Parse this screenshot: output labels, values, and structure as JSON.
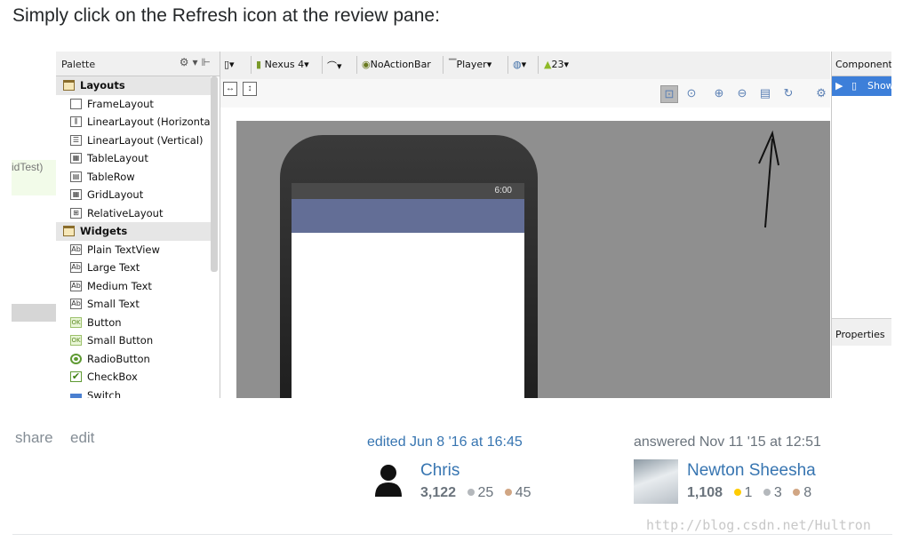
{
  "intro": "Simply click on the Refresh icon at the review pane:",
  "screenshot": {
    "gutter_text": "idTest)",
    "palette": {
      "title": "Palette",
      "items": [
        {
          "type": "category",
          "label": "Layouts"
        },
        {
          "type": "item",
          "label": "FrameLayout",
          "icon": "frame-icon",
          "glyph": ""
        },
        {
          "type": "item",
          "label": "LinearLayout (Horizontal)",
          "icon": "linear-horizontal-icon",
          "glyph": "⫼"
        },
        {
          "type": "item",
          "label": "LinearLayout (Vertical)",
          "icon": "linear-vertical-icon",
          "glyph": "☰"
        },
        {
          "type": "item",
          "label": "TableLayout",
          "icon": "table-icon",
          "glyph": "▦"
        },
        {
          "type": "item",
          "label": "TableRow",
          "icon": "table-row-icon",
          "glyph": "▤"
        },
        {
          "type": "item",
          "label": "GridLayout",
          "icon": "grid-icon",
          "glyph": "▦"
        },
        {
          "type": "item",
          "label": "RelativeLayout",
          "icon": "relative-icon",
          "glyph": "⊞"
        },
        {
          "type": "category",
          "label": "Widgets"
        },
        {
          "type": "item",
          "label": "Plain TextView",
          "icon": "textview-icon",
          "glyph": "Ab"
        },
        {
          "type": "item",
          "label": "Large Text",
          "icon": "textview-icon",
          "glyph": "Ab"
        },
        {
          "type": "item",
          "label": "Medium Text",
          "icon": "textview-icon",
          "glyph": "Ab"
        },
        {
          "type": "item",
          "label": "Small Text",
          "icon": "textview-icon",
          "glyph": "Ab"
        },
        {
          "type": "item",
          "label": "Button",
          "icon": "button-icon",
          "glyph": "OK"
        },
        {
          "type": "item",
          "label": "Small Button",
          "icon": "button-icon",
          "glyph": "OK"
        },
        {
          "type": "item",
          "label": "RadioButton",
          "icon": "radio-icon",
          "glyph": ""
        },
        {
          "type": "item",
          "label": "CheckBox",
          "icon": "checkbox-icon",
          "glyph": "✔"
        },
        {
          "type": "item",
          "label": "Switch",
          "icon": "switch-icon",
          "glyph": ""
        }
      ]
    },
    "toolbar": {
      "device": "Nexus 4",
      "theme": "NoActionBar",
      "activity": "Player",
      "api": "23"
    },
    "phone_time": "6:00",
    "component_tree": {
      "title": "Component",
      "selected": "Show"
    },
    "properties_title": "Properties"
  },
  "post": {
    "share_label": "share",
    "edit_label": "edit",
    "editor": {
      "action": "edited Jun 8 '16 at 16:45",
      "name": "Chris",
      "reputation": "3,122",
      "silver": "25",
      "bronze": "45"
    },
    "answerer": {
      "action": "answered Nov 11 '15 at 12:51",
      "name": "Newton Sheesha",
      "reputation": "1,108",
      "gold": "1",
      "silver": "3",
      "bronze": "8"
    },
    "watermark": "http://blog.csdn.net/Hultron"
  }
}
